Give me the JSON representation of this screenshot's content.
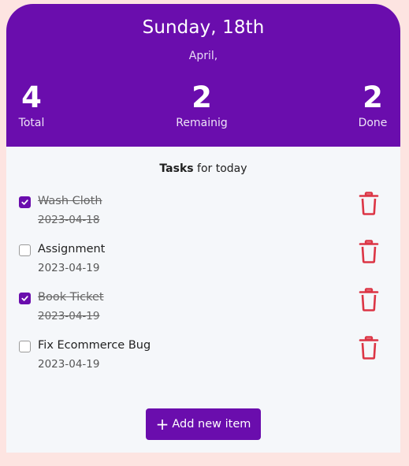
{
  "header": {
    "date_title": "Sunday, 18th",
    "month": "April,",
    "stats": {
      "total": {
        "value": "4",
        "label": "Total"
      },
      "remaining": {
        "value": "2",
        "label": "Remainig"
      },
      "done": {
        "value": "2",
        "label": "Done"
      }
    }
  },
  "tasks_heading": {
    "bold": "Tasks",
    "rest": " for today"
  },
  "tasks": [
    {
      "name": "Wash Cloth",
      "date": "2023-04-18",
      "checked": true
    },
    {
      "name": "Assignment",
      "date": "2023-04-19",
      "checked": false
    },
    {
      "name": "Book Ticket",
      "date": "2023-04-19",
      "checked": true
    },
    {
      "name": "Fix Ecommerce Bug",
      "date": "2023-04-19",
      "checked": false
    }
  ],
  "add_button": {
    "label": "Add new item",
    "icon": "plus-icon"
  },
  "icons": {
    "delete": "trash-icon",
    "check": "check-icon"
  },
  "colors": {
    "accent": "#6a0dad",
    "delete": "#dc3545",
    "page_bg": "#fde4e1",
    "card_bg": "#f5f7fa"
  }
}
